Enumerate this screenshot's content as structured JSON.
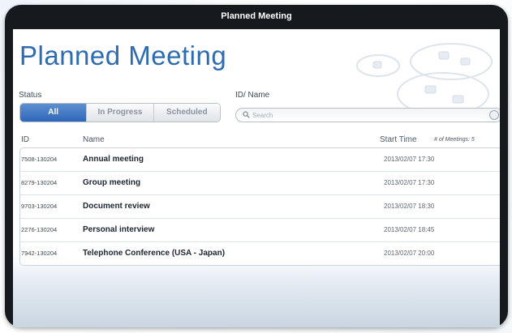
{
  "window": {
    "title": "Planned Meeting"
  },
  "page": {
    "title": "Planned Meeting"
  },
  "filters": {
    "status_label": "Status",
    "status_options": [
      "All",
      "In Progress",
      "Scheduled"
    ],
    "status_selected": "All",
    "idname_label": "ID/ Name",
    "search_placeholder": "Search"
  },
  "table": {
    "headers": {
      "id": "ID",
      "name": "Name",
      "start_time": "Start Time"
    },
    "meetings_count": "# of Meetings: 5",
    "rows": [
      {
        "id": "7508-130204",
        "name": "Annual meeting",
        "start_time": "2013/02/07 17:30"
      },
      {
        "id": "8279-130204",
        "name": "Group meeting",
        "start_time": "2013/02/07 17:30"
      },
      {
        "id": "9703-130204",
        "name": "Document review",
        "start_time": "2013/02/07 18:30"
      },
      {
        "id": "2276-130204",
        "name": "Personal interview",
        "start_time": "2013/02/07 18:45"
      },
      {
        "id": "7942-130204",
        "name": "Telephone Conference (USA - Japan)",
        "start_time": "2013/02/07 20:00"
      }
    ]
  },
  "colors": {
    "accent": "#2d6cb3",
    "frame": "#16191d",
    "segment_active": "#2f66b9"
  }
}
